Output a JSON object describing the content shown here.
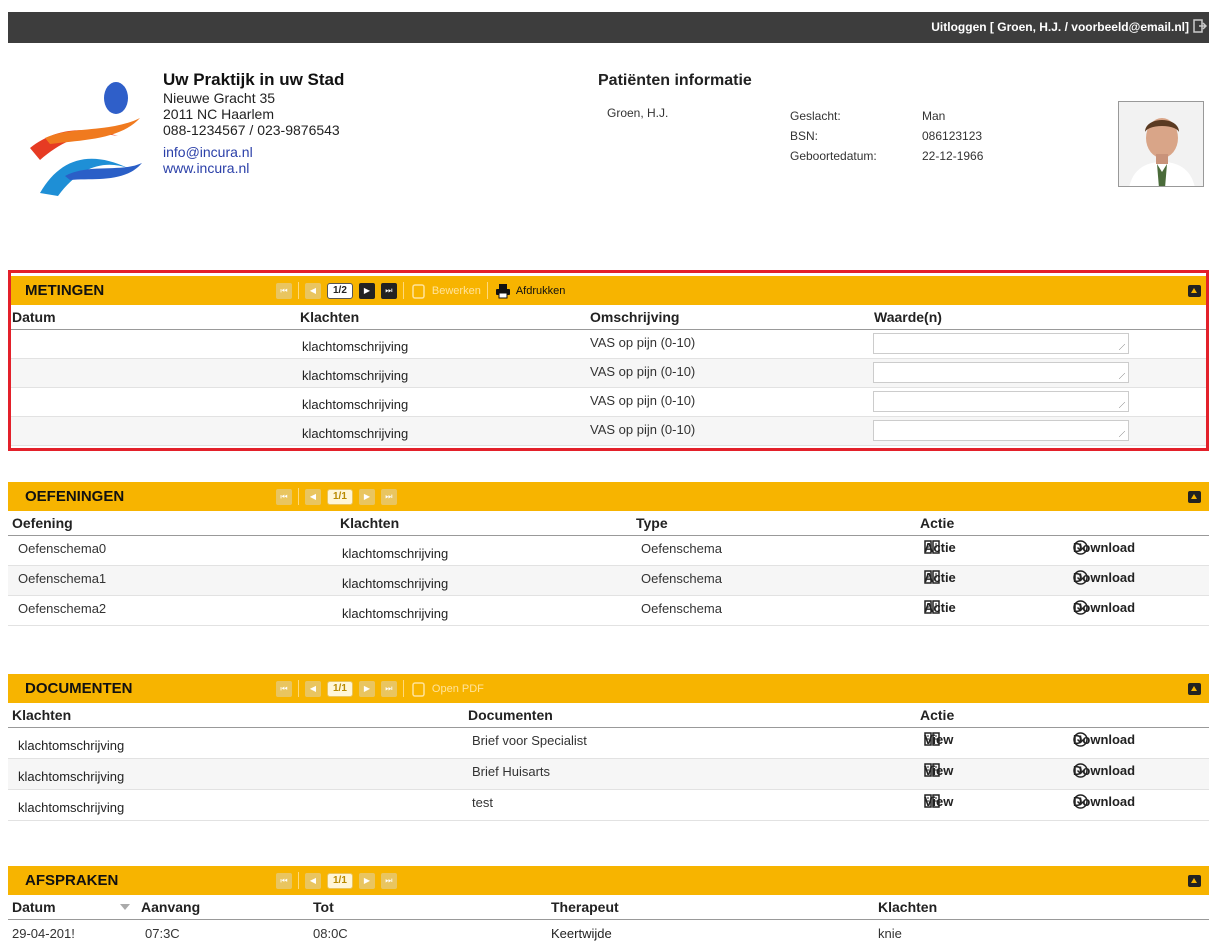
{
  "topbar": {
    "logout": "Uitloggen [ Groen, H.J. / voorbeeld@email.nl]"
  },
  "practice": {
    "name": "Uw Praktijk in uw Stad",
    "street": "Nieuwe Gracht 35",
    "city": "2011 NC Haarlem",
    "phone": "088-1234567 / 023-9876543",
    "email": "info@incura.nl",
    "web": "www.incura.nl"
  },
  "patient": {
    "title": "Patiënten informatie",
    "name": "Groen, H.J.",
    "gender_label": "Geslacht:",
    "gender": "Man",
    "bsn_label": "BSN:",
    "bsn": "086123123",
    "dob_label": "Geboortedatum:",
    "dob": "22-12-1966"
  },
  "metingen": {
    "title": "METINGEN",
    "page": "1/2",
    "edit": "Bewerken",
    "print": "Afdrukken",
    "cols": [
      "Datum",
      "Klachten",
      "Omschrijving",
      "Waarde(n)"
    ],
    "rows": [
      {
        "datum": "",
        "klacht": "klachtomschrijving",
        "omschrijving": "VAS op pijn (0-10)"
      },
      {
        "datum": "",
        "klacht": "klachtomschrijving",
        "omschrijving": "VAS op pijn (0-10)"
      },
      {
        "datum": "",
        "klacht": "klachtomschrijving",
        "omschrijving": "VAS op pijn (0-10)"
      },
      {
        "datum": "",
        "klacht": "klachtomschrijving",
        "omschrijving": "VAS op pijn (0-10)"
      }
    ]
  },
  "oefeningen": {
    "title": "OEFENINGEN",
    "page": "1/1",
    "cols": [
      "Oefening",
      "Klachten",
      "Type",
      "Actie"
    ],
    "rows": [
      {
        "oefening": "Oefenschema0",
        "klacht": "klachtomschrijving",
        "type": "Oefenschema",
        "actie": "Actie",
        "download": "Download"
      },
      {
        "oefening": "Oefenschema1",
        "klacht": "klachtomschrijving",
        "type": "Oefenschema",
        "actie": "Actie",
        "download": "Download"
      },
      {
        "oefening": "Oefenschema2",
        "klacht": "klachtomschrijving",
        "type": "Oefenschema",
        "actie": "Actie",
        "download": "Download"
      }
    ]
  },
  "documenten": {
    "title": "DOCUMENTEN",
    "page": "1/1",
    "open_pdf": "Open PDF",
    "cols": [
      "Klachten",
      "Documenten",
      "Actie"
    ],
    "rows": [
      {
        "klacht": "klachtomschrijving",
        "document": "Brief voor Specialist",
        "view": "View",
        "download": "Download"
      },
      {
        "klacht": "klachtomschrijving",
        "document": "Brief Huisarts",
        "view": "View",
        "download": "Download"
      },
      {
        "klacht": "klachtomschrijving",
        "document": "test",
        "view": "View",
        "download": "Download"
      }
    ]
  },
  "afspraken": {
    "title": "AFSPRAKEN",
    "page": "1/1",
    "cols": [
      "Datum",
      "Aanvang",
      "Tot",
      "Therapeut",
      "Klachten"
    ],
    "rows": [
      {
        "datum": "29-04-201!",
        "aanvang": "07:3C",
        "tot": "08:0C",
        "therapeut": "Keertwijde",
        "klacht": "knie"
      }
    ]
  }
}
